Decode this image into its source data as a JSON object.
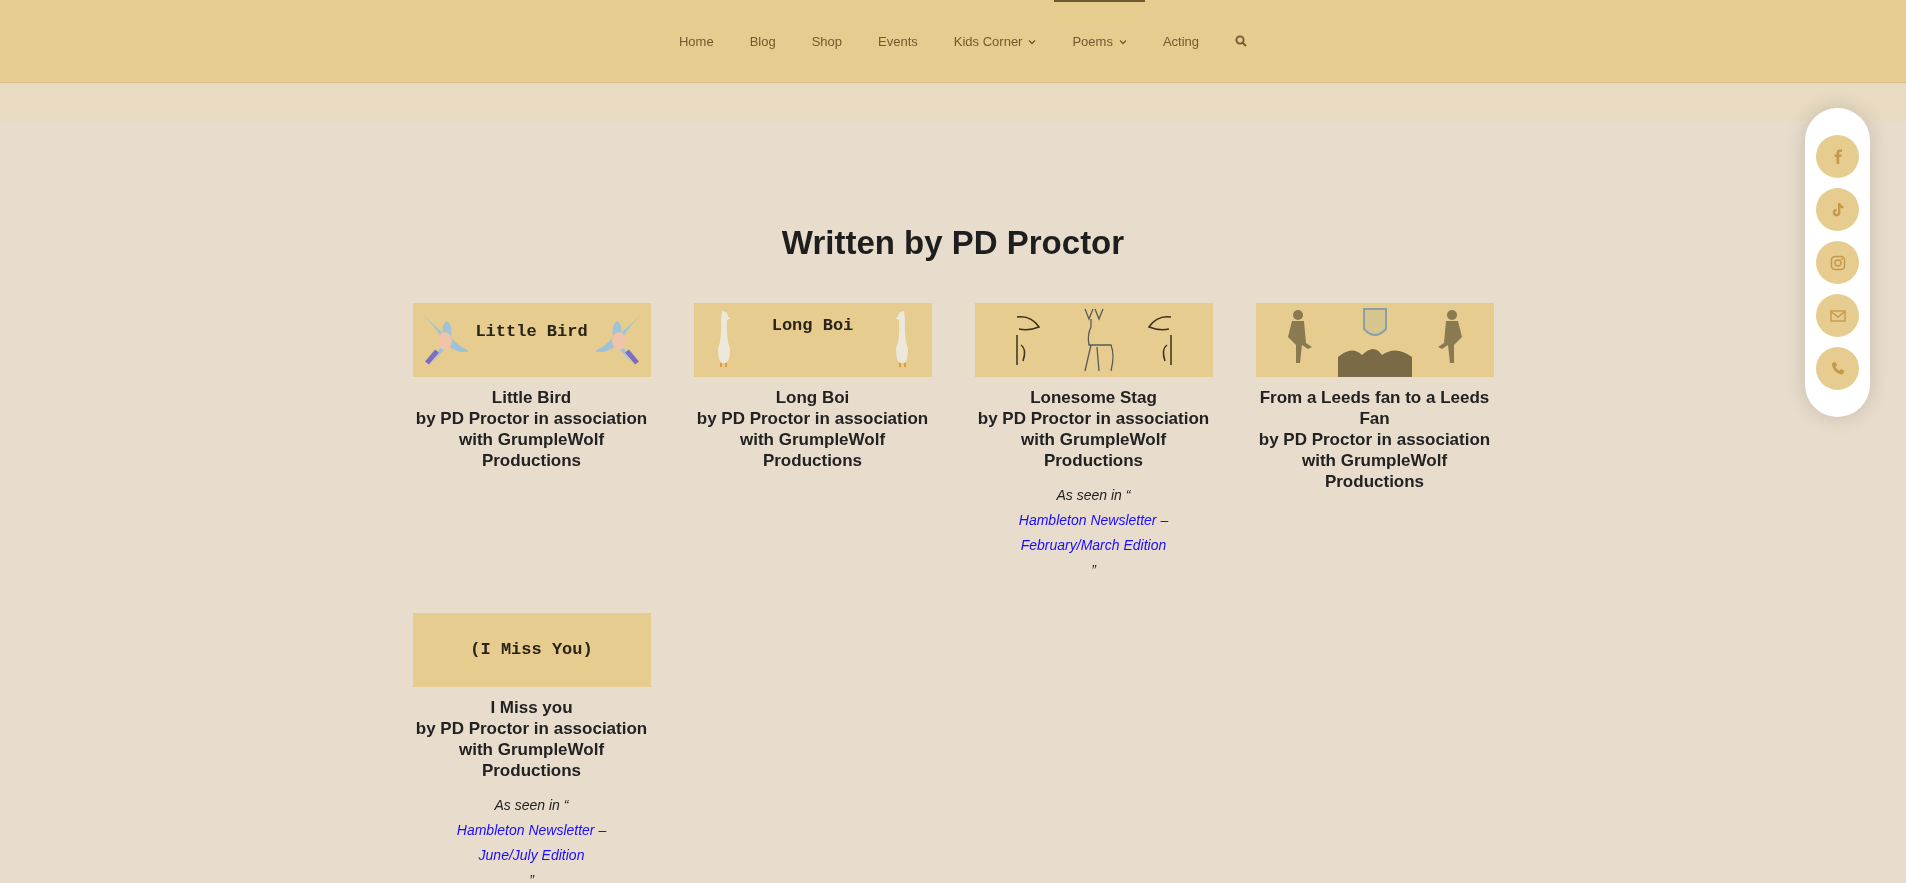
{
  "nav": {
    "items": [
      {
        "label": "Home",
        "dropdown": false,
        "selected": false
      },
      {
        "label": "Blog",
        "dropdown": false,
        "selected": false
      },
      {
        "label": "Shop",
        "dropdown": false,
        "selected": false
      },
      {
        "label": "Events",
        "dropdown": false,
        "selected": false
      },
      {
        "label": "Kids Corner",
        "dropdown": true,
        "selected": false
      },
      {
        "label": "Poems",
        "dropdown": true,
        "selected": true
      },
      {
        "label": "Acting",
        "dropdown": false,
        "selected": false
      }
    ]
  },
  "heading": "Written by PD Proctor",
  "poems": [
    {
      "banner_text": "Little Bird",
      "kind": "birds",
      "title": "Little Bird",
      "byline": "by PD Proctor in association with GrumpleWolf Productions"
    },
    {
      "banner_text": "Long Boi",
      "kind": "ducks",
      "title": "Long Boi",
      "byline": "by PD Proctor in association with GrumpleWolf Productions"
    },
    {
      "kind": "stag",
      "title": "Lonesome Stag",
      "byline": "by PD Proctor in association with GrumpleWolf Productions",
      "note": {
        "prefix": "As seen in “",
        "link": "Hambleton Newsletter – February/March Edition",
        "suffix": "”"
      }
    },
    {
      "kind": "football",
      "title": "From a Leeds fan to a Leeds Fan",
      "byline": "by PD Proctor in association with GrumpleWolf Productions"
    },
    {
      "banner_text": "(I Miss You)",
      "kind": "plain",
      "title": "I Miss you",
      "byline": "by PD Proctor in association with GrumpleWolf Productions",
      "note": {
        "prefix": "As seen in “",
        "link": "Hambleton Newsletter – June/July Edition",
        "suffix": "”"
      }
    }
  ],
  "social": [
    {
      "kind": "facebook"
    },
    {
      "kind": "tiktok"
    },
    {
      "kind": "instagram"
    },
    {
      "kind": "email"
    },
    {
      "kind": "phone"
    }
  ]
}
